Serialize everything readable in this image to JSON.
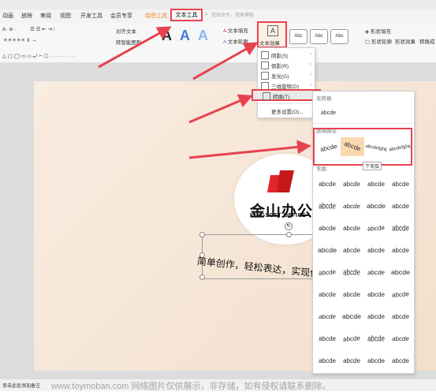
{
  "menu": {
    "tabs": [
      "动画",
      "放映",
      "审阅",
      "视图",
      "开发工具",
      "会员专享"
    ],
    "drawing_tool": "绘图工具",
    "text_tool": "文本工具",
    "search_placeholder": "查找命令、搜索模板"
  },
  "ribbon": {
    "align_text": "对齐文本",
    "convert_smartart": "转智能图形",
    "text_fill": "文本填充",
    "text_outline": "文本轮廓",
    "text_effect": "文本效果",
    "style_labels": [
      "Abc",
      "Abc",
      "Abc"
    ],
    "shape_fill": "形状填充",
    "shape_outline": "形状轮廓",
    "shape_effect": "形状效果",
    "convert": "转换成"
  },
  "effect_menu": {
    "items": [
      "阴影(S)",
      "倒影(R)",
      "发光(G)",
      "三维旋转(D)",
      "转换(T)",
      "更多设置(O)..."
    ]
  },
  "transform_panel": {
    "no_transform": "无转换",
    "plain": "abcde",
    "follow_path": "跟随路径",
    "warp": "弯曲",
    "path_cells": [
      "abcde",
      "abcde",
      "abcdefghij"
    ],
    "tooltip": "下弯弧",
    "warp_cells": [
      "abcde",
      "abcde",
      "abcde",
      "abcde",
      "abcde",
      "abcde",
      "abcde",
      "abcde",
      "abcde",
      "abcde",
      "abcde",
      "abcde",
      "abcde",
      "abcde",
      "abcde",
      "abcde",
      "abcde",
      "abcde",
      "abcde",
      "abcde",
      "abcde",
      "abcde",
      "abcde",
      "abcde",
      "abcde",
      "abcde",
      "abcde",
      "abcde",
      "abcde",
      "abcde",
      "abcde",
      "abcde",
      "abcde",
      "abcde",
      "abcde",
      "abcde"
    ]
  },
  "slide": {
    "logo_title": "金山办公",
    "logo_sub": "KINGSOFT OFFICE",
    "body_text": "简单创作，轻松表达，实现你"
  },
  "status": {
    "left": "单击此处添加备注",
    "watermark": "www.toymoban.com 网络图片仅供展示，非存储，如有侵权请联系删除。"
  },
  "colors": {
    "highlight": "#e8414f",
    "drawing_tab": "#e8891b",
    "blue_a": "#3b7ddd",
    "logo_red": "#e0262b"
  }
}
